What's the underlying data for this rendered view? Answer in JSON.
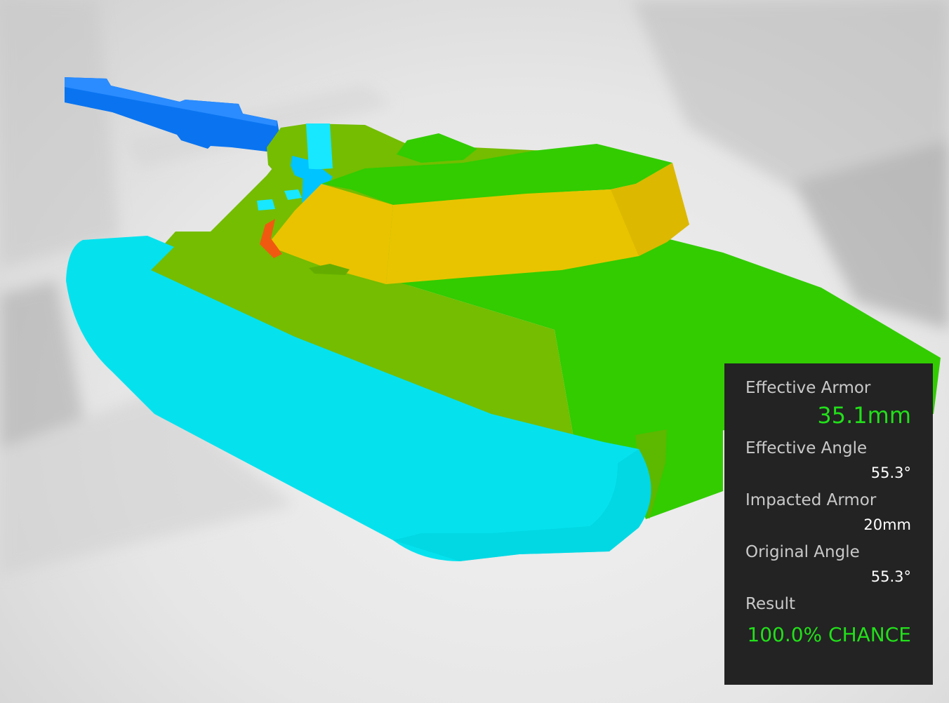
{
  "info_panel": {
    "effective_armor": {
      "label": "Effective Armor",
      "value": "35.1mm"
    },
    "effective_angle": {
      "label": "Effective Angle",
      "value": "55.3°"
    },
    "impacted_armor": {
      "label": "Impacted Armor",
      "value": "20mm"
    },
    "original_angle": {
      "label": "Original Angle",
      "value": "55.3°"
    },
    "result": {
      "label": "Result",
      "value": "100.0% CHANCE"
    }
  },
  "colors": {
    "highlight_green": "#22e01a",
    "panel_background": "#232323",
    "tracks": "#05e2ee",
    "gun_barrel": "#0a74f0",
    "hull_front": "#74bd00",
    "hull_side": "#32cc00",
    "turret": "#e9c300",
    "weak_spot": "#f05a10"
  }
}
